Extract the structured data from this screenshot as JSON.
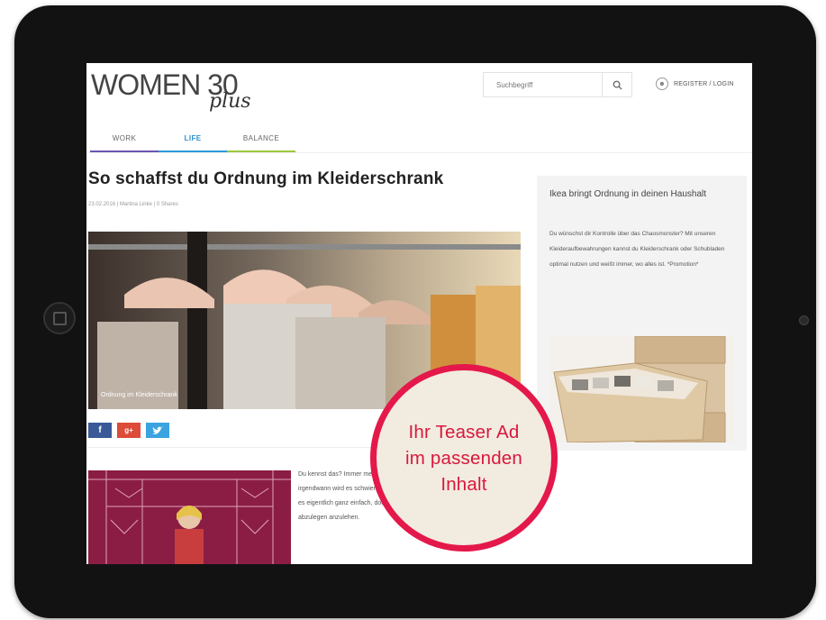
{
  "site": {
    "logo_main": "WOMEN 30",
    "logo_sub": "plus"
  },
  "header": {
    "search": {
      "placeholder": "Suchbegriff"
    },
    "login_label": "REGISTER / LOGIN"
  },
  "nav": {
    "items": [
      {
        "label": "WORK"
      },
      {
        "label": "LIFE"
      },
      {
        "label": "BALANCE"
      }
    ]
  },
  "article": {
    "title": "So schaffst du Ordnung im Kleiderschrank",
    "meta": "23.02.2016  |  Martina Linke  |  0 Shares",
    "image_caption": "Ordnung im Kleiderschrank",
    "teaser": "Du kennst das? Immer mehr Kleidungsstücke sammeln sich an und irgendwann wird es schwierig, im Kleiderschrank Ordnung zu halten. Dabei ist es eigentlich ganz einfach, doch scheint es, die hässlichen Gewohnheiten abzulegen anzulehen."
  },
  "share": {
    "facebook": "f",
    "google": "g+",
    "twitter": "t"
  },
  "sidebar": {
    "title": "Ikea bringt Ordnung in deinen Haushalt",
    "text": "Du wünschst dir Kontrolle über das Chaosmonster? Mit unseren Kleideraufbewahrungen kannst du Kleiderschrank oder Schubladen optimal nutzen und weißt immer, wo alles ist. *Promotion*"
  },
  "overlay": {
    "line1": "Ihr Teaser Ad",
    "line2": "im passenden",
    "line3": "Inhalt"
  },
  "colors": {
    "accent": "#e4184a",
    "overlay_bg": "#f2ebe0",
    "nav_work": "#6a56b0",
    "nav_life": "#2d9bdb",
    "nav_balance": "#9dc83c"
  }
}
